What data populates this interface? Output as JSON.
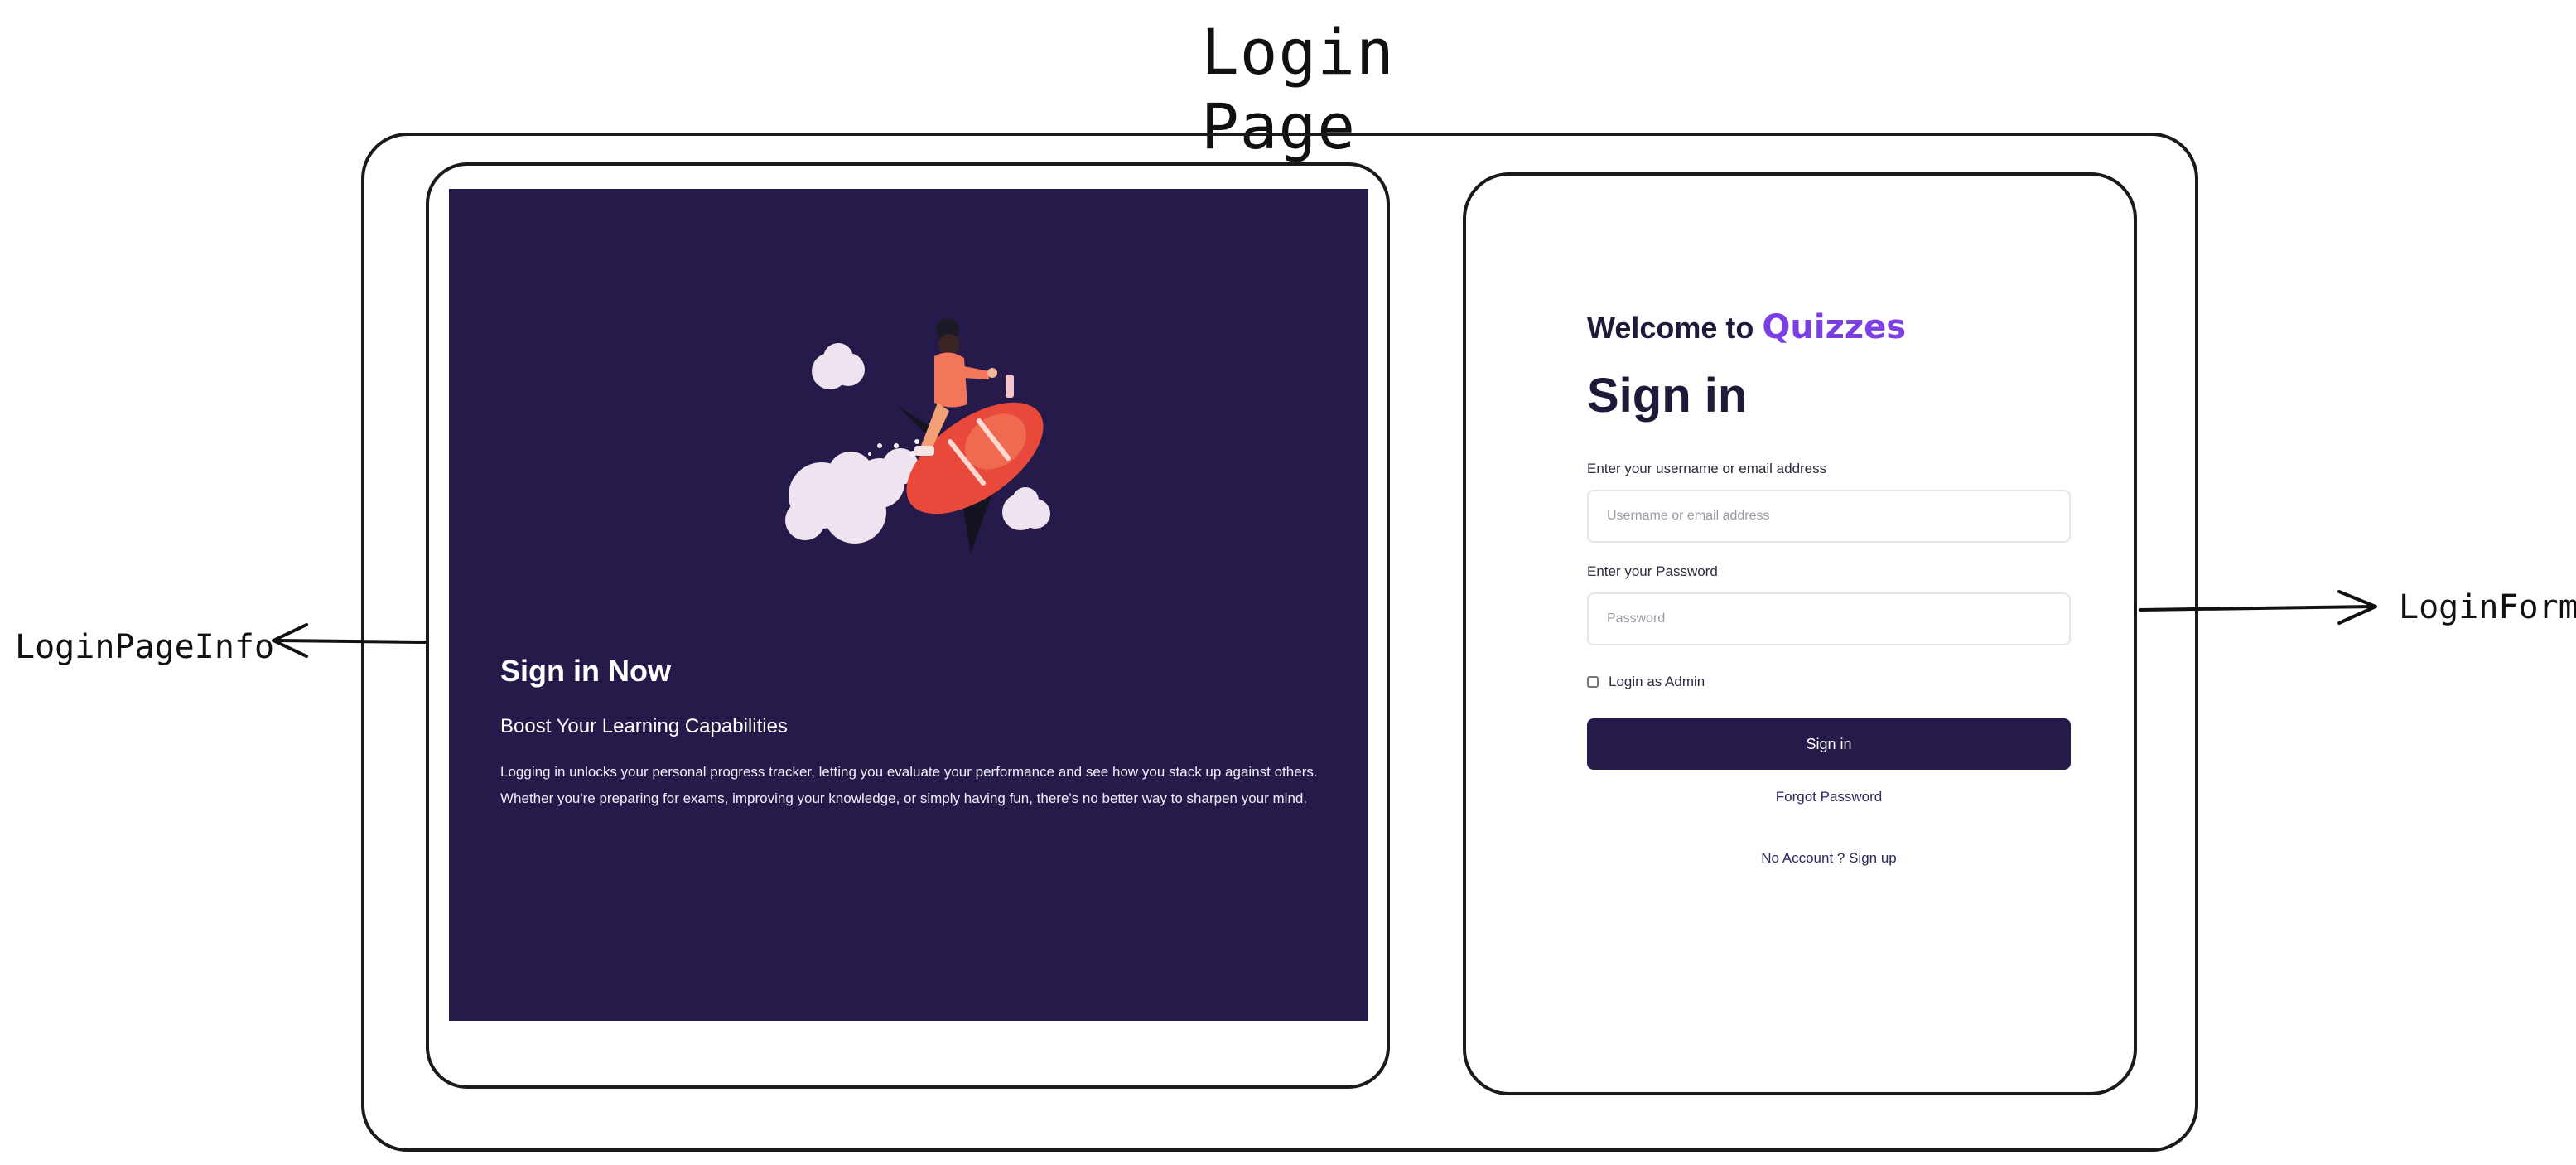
{
  "diagram": {
    "title": "Login Page",
    "label_left": "LoginPageInfo",
    "label_right": "LoginForm"
  },
  "info_panel": {
    "heading": "Sign in Now",
    "subheading": "Boost Your Learning Capabilities",
    "body": "Logging in unlocks your personal progress tracker, letting you evaluate your performance and see how you stack up against others. Whether you're preparing for exams, improving your knowledge, or simply having fun, there's no better way to sharpen your mind.",
    "background_color": "#261a4a",
    "illustration_icon": "rocket-rider-illustration"
  },
  "login_form": {
    "welcome_prefix": "Welcome to",
    "brand": "Quizzes",
    "brand_color": "#7b3fe4",
    "title": "Sign in",
    "username_label": "Enter your username or email address",
    "username_placeholder": "Username or email address",
    "password_label": "Enter your Password",
    "password_placeholder": "Password",
    "admin_checkbox_label": "Login as Admin",
    "submit_label": "Sign in",
    "forgot_password": "Forgot Password",
    "signup_prompt": "No Account ? Sign up"
  }
}
